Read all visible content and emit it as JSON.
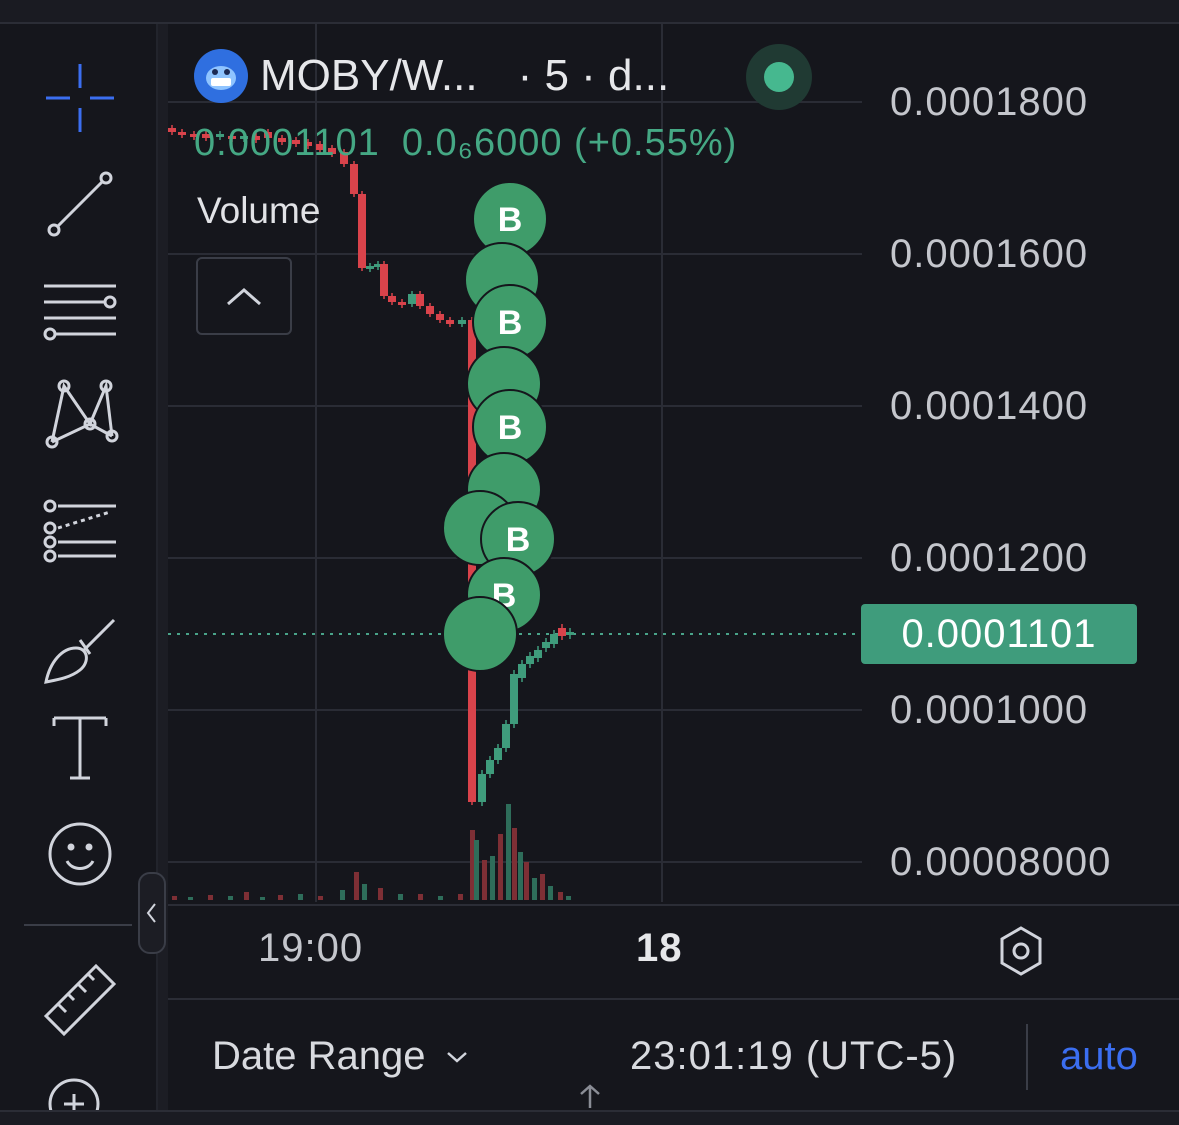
{
  "legend": {
    "symbol": "MOBY/W...",
    "meta": "· 5 · d...",
    "price": "0.0001101",
    "change": "0.0₆6000 (+0.55%)",
    "volume_label": "Volume"
  },
  "price_axis": {
    "ticks": [
      "0.0001800",
      "0.0001600",
      "0.0001400",
      "0.0001200",
      "0.0001000",
      "0.00008000"
    ],
    "current_price": "0.0001101"
  },
  "time_axis": {
    "labels": [
      "19:00",
      "18"
    ]
  },
  "markers": {
    "buy_label": "B"
  },
  "bottom_bar": {
    "date_range": "Date Range",
    "clock": "23:01:19 (UTC-5)",
    "auto": "auto"
  },
  "colors": {
    "up": "#3f9c7c",
    "down": "#d9434b",
    "marker": "#3f9c6a",
    "accent": "#3b6ef0",
    "background": "#15161c"
  },
  "toolbar": {
    "icons": [
      "crosshair-icon",
      "trend-line-icon",
      "fib-retracement-icon",
      "pattern-icon",
      "forecast-icon",
      "brush-icon",
      "text-icon",
      "emoji-icon",
      "ruler-icon",
      "zoom-in-icon"
    ]
  }
}
